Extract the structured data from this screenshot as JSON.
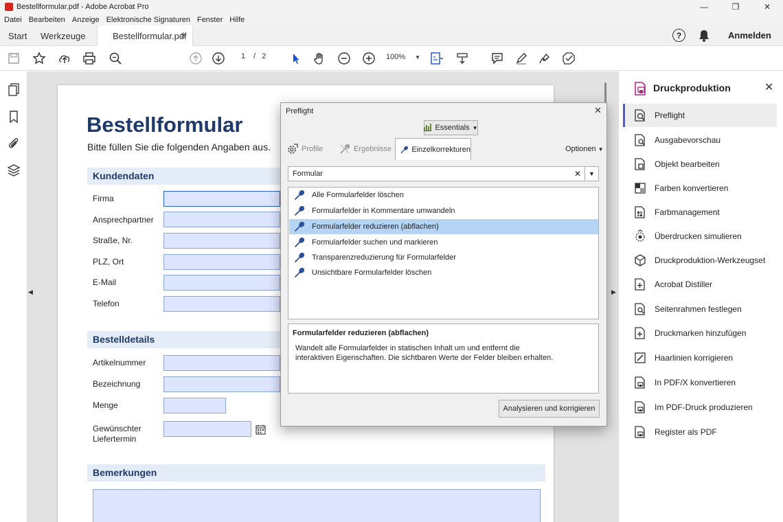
{
  "window": {
    "title": "Bestellformular.pdf - Adobe Acrobat Pro"
  },
  "menu": [
    "Datei",
    "Bearbeiten",
    "Anzeige",
    "Elektronische Signaturen",
    "Fenster",
    "Hilfe"
  ],
  "tabs": {
    "start": "Start",
    "tools": "Werkzeuge",
    "document": "Bestellformular.pdf"
  },
  "header": {
    "login": "Anmelden"
  },
  "toolbar": {
    "page_current": "1",
    "page_separator": "/",
    "page_total": "2",
    "zoom": "100%"
  },
  "document": {
    "title": "Bestellformular",
    "subtitle": "Bitte füllen Sie die folgenden Angaben aus.",
    "sections": [
      "Kundendaten",
      "Bestelldetails",
      "Bemerkungen"
    ],
    "customer_fields": [
      "Firma",
      "Ansprechpartner",
      "Straße, Nr.",
      "PLZ, Ort",
      "E-Mail",
      "Telefon"
    ],
    "order_fields": [
      "Artikelnummer",
      "Bezeichnung",
      "Menge",
      "Gewünschter\nLiefertermin"
    ]
  },
  "preflight": {
    "title": "Preflight",
    "essentials": "Essentials",
    "tabs": [
      "Profile",
      "Ergebnisse",
      "Einzelkorrekturen"
    ],
    "options": "Optionen",
    "search_value": "Formular",
    "list": [
      "Alle Formularfelder löschen",
      "Formularfelder in Kommentare umwandeln",
      "Formularfelder reduzieren (abflachen)",
      "Formularfelder suchen und markieren",
      "Transparenzreduzierung für Formularfelder",
      "Unsichtbare Formularfelder löschen"
    ],
    "selected_index": 2,
    "description_title": "Formularfelder reduzieren (abflachen)",
    "description_body": "Wandelt alle Formularfelder in statischen Inhalt um und entfernt die interaktiven Eigenschaften. Die sichtbaren Werte der Felder bleiben erhalten.",
    "run_button": "Analysieren und korrigieren"
  },
  "right_panel": {
    "title": "Druckproduktion",
    "items": [
      "Preflight",
      "Ausgabevorschau",
      "Objekt bearbeiten",
      "Farben konvertieren",
      "Farbmanagement",
      "Überdrucken simulieren",
      "Druckproduktion-Werkzeugset",
      "Acrobat Distiller",
      "Seitenrahmen festlegen",
      "Druckmarken hinzufügen",
      "Haarlinien korrigieren",
      "In PDF/X konvertieren",
      "Im PDF-Druck produzieren",
      "Register als PDF"
    ],
    "active_index": 0
  },
  "colors": {
    "accent": "#4b5bd6",
    "doc_heading": "#1f3a68",
    "field_fill": "#dde5ff",
    "selection": "#b5d4f4",
    "acrobat_red": "#d7261e"
  }
}
